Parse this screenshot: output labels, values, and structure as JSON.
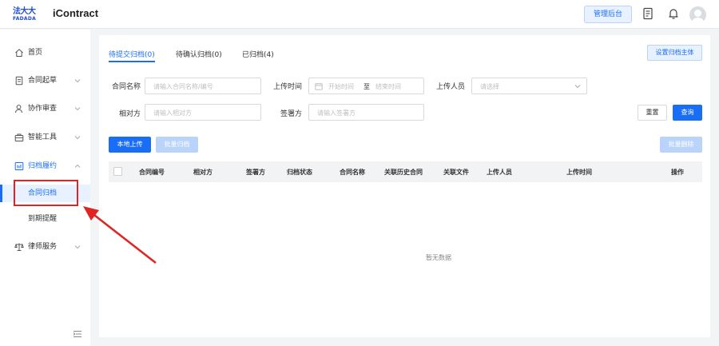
{
  "header": {
    "logo_cn": "法大大",
    "logo_en": "FADADA",
    "app_title": "iContract",
    "admin_button": "管理后台",
    "icons": [
      "document-icon",
      "bell-icon",
      "avatar"
    ]
  },
  "sidebar": {
    "items": [
      {
        "label": "首页",
        "icon": "home-icon"
      },
      {
        "label": "合同起草",
        "icon": "document-icon"
      },
      {
        "label": "协作审查",
        "icon": "user-icon"
      },
      {
        "label": "智能工具",
        "icon": "briefcase-icon"
      },
      {
        "label": "归档履约",
        "icon": "archive-icon"
      },
      {
        "label": "律师服务",
        "icon": "scale-icon"
      }
    ],
    "sub_items": [
      {
        "label": "合同归档",
        "selected": true
      },
      {
        "label": "到期提醒",
        "selected": false
      }
    ]
  },
  "tabs": [
    {
      "label": "待提交归档(0)",
      "active": true
    },
    {
      "label": "待确认归档(0)",
      "active": false
    },
    {
      "label": "已归档(4)",
      "active": false
    }
  ],
  "toolbar": {
    "set_archive_subject": "设置归档主体",
    "reset": "重置",
    "query": "查询",
    "local_upload": "本地上传",
    "batch_archive": "批量归档",
    "batch_delete": "批量删除"
  },
  "filters": {
    "contract_name": {
      "label": "合同名称",
      "placeholder": "请输入合同名称/编号"
    },
    "upload_time": {
      "label": "上传时间",
      "start": "开始时间",
      "to": "至",
      "end": "结束时间"
    },
    "uploader": {
      "label": "上传人员",
      "placeholder": "请选择"
    },
    "counterparty": {
      "label": "相对方",
      "placeholder": "请输入相对方"
    },
    "signatory": {
      "label": "签署方",
      "placeholder": "请输入签署方"
    }
  },
  "table": {
    "columns": [
      "合同编号",
      "相对方",
      "签署方",
      "归档状态",
      "合同名称",
      "关联历史合同",
      "关联文件",
      "上传人员",
      "上传时间",
      "操作"
    ],
    "rows": [],
    "empty_text": "暂无数据"
  },
  "colors": {
    "primary": "#1a6ef5",
    "highlight": "#e02424"
  }
}
